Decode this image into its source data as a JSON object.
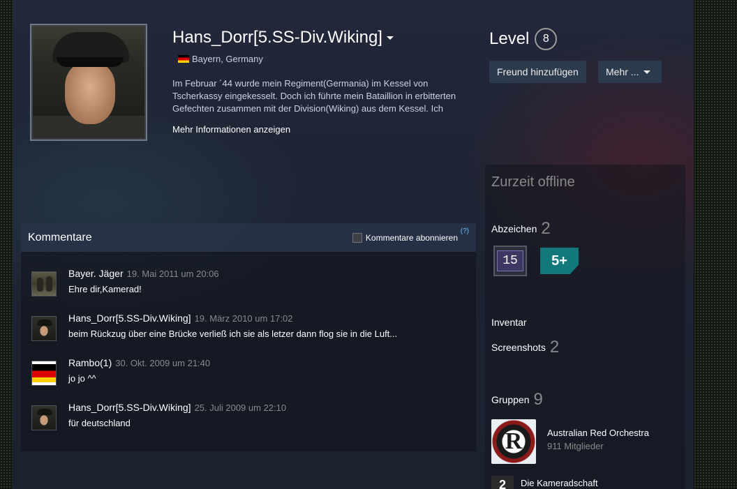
{
  "profile": {
    "persona_name": "Hans_Dorr[5.SS-Div.Wiking]",
    "location": "Bayern, Germany",
    "summary": "Im Februar ´44 wurde mein Regiment(Germania) im Kessel von Tscherkassy eingekesselt. Doch ich führte mein Bataillion in erbitterten Gefechten zusammen mit der Division(Wiking) aus dem Kessel. Ich",
    "more_info_label": "Mehr Informationen anzeigen"
  },
  "level": {
    "label": "Level",
    "value": "8"
  },
  "actions": {
    "add_friend_label": "Freund hinzufügen",
    "more_label": "Mehr ..."
  },
  "status": {
    "online_state": "Zurzeit offline"
  },
  "badges": {
    "label": "Abzeichen",
    "count": "2",
    "items": [
      "15",
      "5+"
    ]
  },
  "inventory": {
    "label": "Inventar"
  },
  "screenshots": {
    "label": "Screenshots",
    "count": "2"
  },
  "groups": {
    "label": "Gruppen",
    "count": "9",
    "items": [
      {
        "name": "Australian Red Orchestra",
        "members": "911 Mitglieder",
        "avatar_text": "R"
      },
      {
        "name": "Die Kameradschaft",
        "avatar_text": "2"
      }
    ]
  },
  "comments": {
    "title": "Kommentare",
    "subscribe_label": "Kommentare abonnieren",
    "help_label": "(?)",
    "items": [
      {
        "author": "Bayer. Jäger",
        "date": "19. Mai 2011 um 20:06",
        "text": "Ehre dir,Kamerad!"
      },
      {
        "author": "Hans_Dorr[5.SS-Div.Wiking]",
        "date": "19. März 2010 um 17:02",
        "text": "beim Rückzug über eine Brücke verließ ich sie als letzer dann flog sie in die Luft..."
      },
      {
        "author": "Rambo(1)",
        "date": "30. Okt. 2009 um 21:40",
        "text": "jo jo ^^"
      },
      {
        "author": "Hans_Dorr[5.SS-Div.Wiking]",
        "date": "25. Juli 2009 um 22:10",
        "text": "für deutschland"
      }
    ]
  },
  "colors": {
    "button_bg": "#2c3a4d",
    "muted_text": "#898989",
    "link_blue": "#66c0f4",
    "badge_teal": "#12787a",
    "badge_purple": "#3d3863"
  }
}
